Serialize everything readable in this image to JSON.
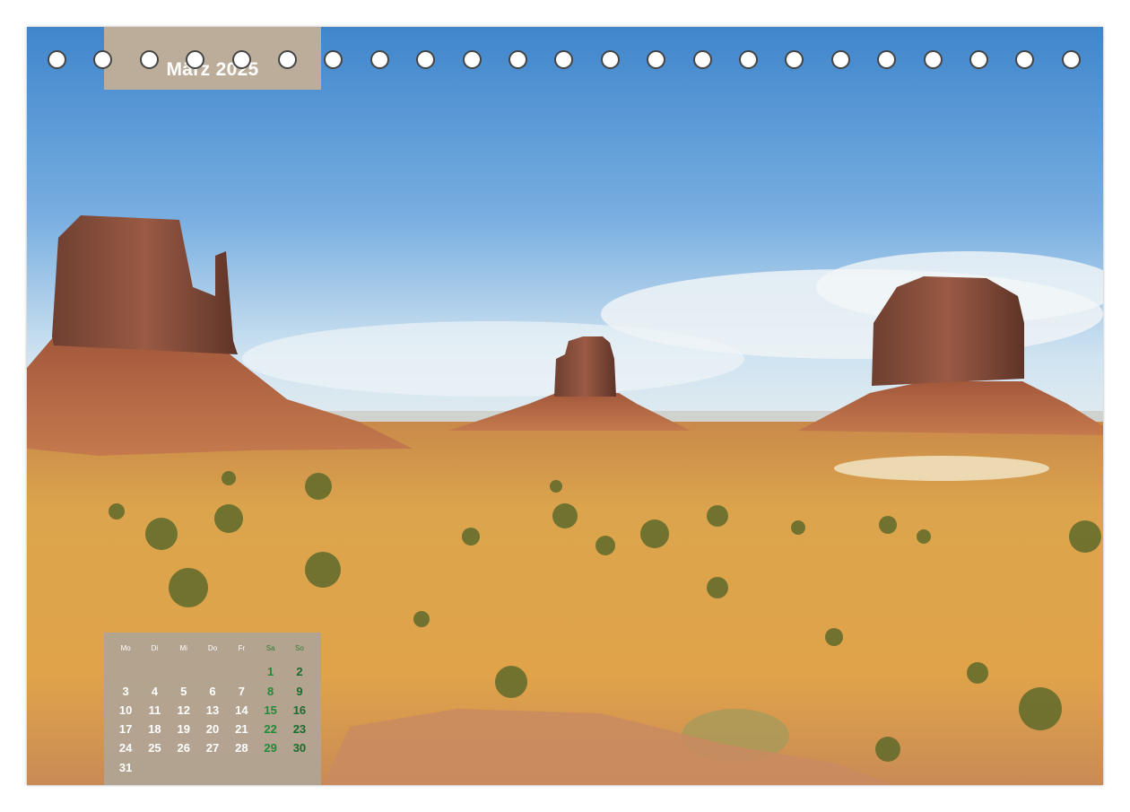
{
  "calendar": {
    "month_title": "März 2025",
    "weekdays": [
      "Mo",
      "Di",
      "Mi",
      "Do",
      "Fr",
      "Sa",
      "So"
    ],
    "weeks": [
      [
        "",
        "",
        "",
        "",
        "",
        "1",
        "2"
      ],
      [
        "3",
        "4",
        "5",
        "6",
        "7",
        "8",
        "9"
      ],
      [
        "10",
        "11",
        "12",
        "13",
        "14",
        "15",
        "16"
      ],
      [
        "17",
        "18",
        "19",
        "20",
        "21",
        "22",
        "23"
      ],
      [
        "24",
        "25",
        "26",
        "27",
        "28",
        "29",
        "30"
      ],
      [
        "31",
        "",
        "",
        "",
        "",
        "",
        ""
      ]
    ]
  },
  "binding": {
    "hole_count": 23
  },
  "photo": {
    "subject": "monument-valley-buttes"
  },
  "colors": {
    "month_box": "#bcad9b",
    "calendar_box": "#b0a494",
    "weekend_text": "#1f8a3a",
    "sky_top": "#4a8fd0",
    "sand": "#d9a24a"
  }
}
